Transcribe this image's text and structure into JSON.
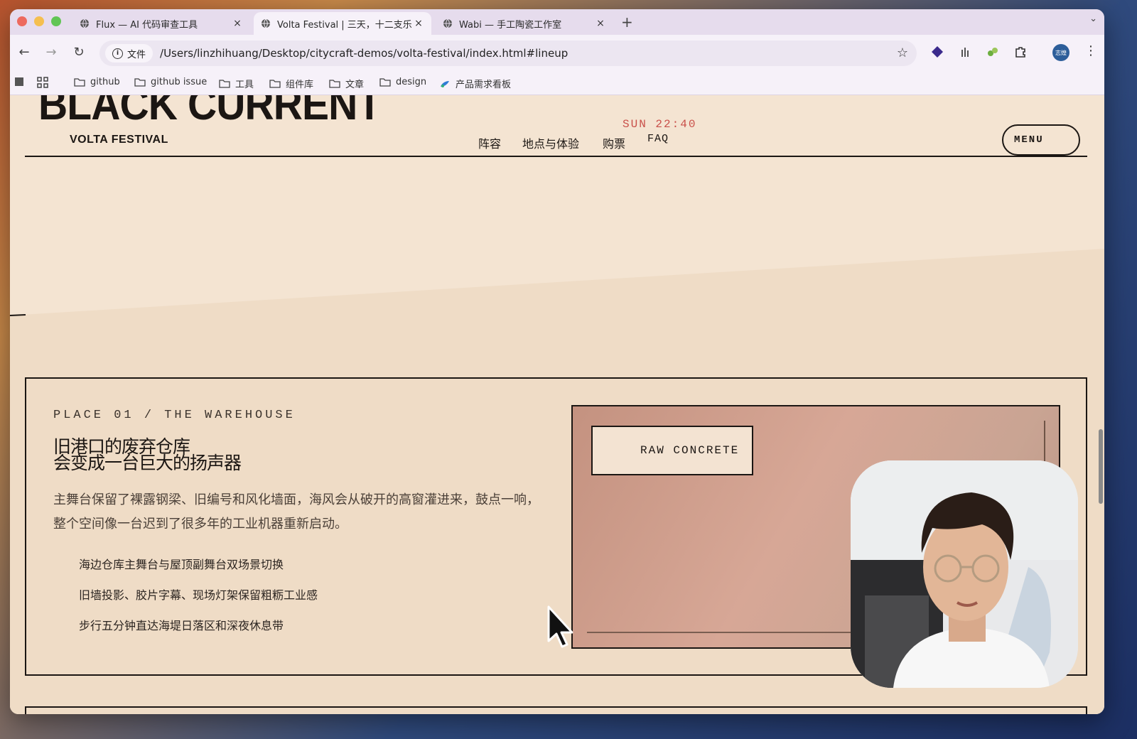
{
  "browser": {
    "tabs": [
      {
        "title": "Flux — AI 代码审查工具",
        "active": false
      },
      {
        "title": "Volta Festival | 三天，十二支乐",
        "active": true
      },
      {
        "title": "Wabi — 手工陶瓷工作室",
        "active": false
      }
    ],
    "new_tab": "+",
    "close_glyph": "×",
    "address": {
      "info_label": "文件",
      "url": "/Users/linzhihuang/Desktop/citycraft-demos/volta-festival/index.html#lineup"
    },
    "avatar_text": "志煌",
    "bookmarks": [
      "github",
      "github issue",
      "工具",
      "组件库",
      "文章",
      "design",
      "产品需求看板"
    ]
  },
  "site": {
    "logo": "BLACK CURRENT",
    "logo_sub": "VOLTA FESTIVAL",
    "clock": "SUN 22:40",
    "nav": [
      "阵容",
      "地点与体验",
      "购票",
      "FAQ"
    ],
    "menu_label": "MENU"
  },
  "place": {
    "label": "PLACE 01 / THE WAREHOUSE",
    "title_line1": "旧港口的废弃仓库",
    "title_line2": "会变成一台巨大的扬声器",
    "description": "主舞台保留了裸露钢梁、旧编号和风化墙面，海风会从破开的高窗灌进来，鼓点一响，整个空间像一台迟到了很多年的工业机器重新启动。",
    "features": [
      "海边仓库主舞台与屋顶副舞台双场景切换",
      "旧墙投影、胶片字幕、现场灯架保留粗粝工业感",
      "步行五分钟直达海堤日落区和深夜休息带"
    ],
    "photo_tag": "RAW CONCRETE"
  },
  "colors": {
    "page_bg": "#f4e4d2",
    "ink": "#1b1613",
    "clock": "#c9504a",
    "photo": "#d7a796"
  }
}
